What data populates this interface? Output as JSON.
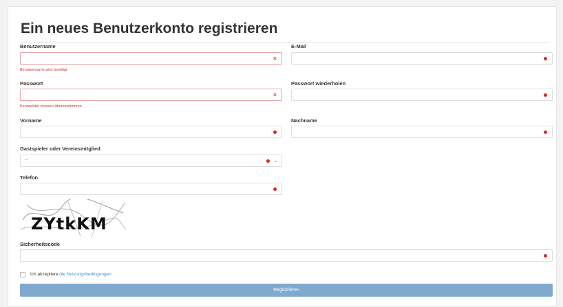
{
  "page": {
    "title": "Ein neues Benutzerkonto registrieren"
  },
  "form": {
    "username": {
      "label": "Benutzername",
      "error": "Benutzername wird benötigt"
    },
    "email": {
      "label": "E-Mail"
    },
    "password": {
      "label": "Passwort",
      "error": "Kennwörter müssen übereinstimmen."
    },
    "password_repeat": {
      "label": "Passwort wiederholen"
    },
    "firstname": {
      "label": "Vorname"
    },
    "lastname": {
      "label": "Nachname"
    },
    "membership": {
      "label": "Gastspieler oder Vereinsmitglied",
      "value": "--"
    },
    "phone": {
      "label": "Telefon"
    },
    "captcha": {
      "text": "ZYtkKM"
    },
    "security_code": {
      "label": "Sicherheitscode"
    },
    "terms": {
      "prefix": "Ich akzeptiere",
      "link": "die Nutzungsbedingungen"
    },
    "submit_label": "Registrieren"
  },
  "colors": {
    "error": "#d9272e",
    "button": "#80a9d0",
    "link": "#3c8dbc"
  },
  "icons": {
    "error_mark": "×"
  }
}
